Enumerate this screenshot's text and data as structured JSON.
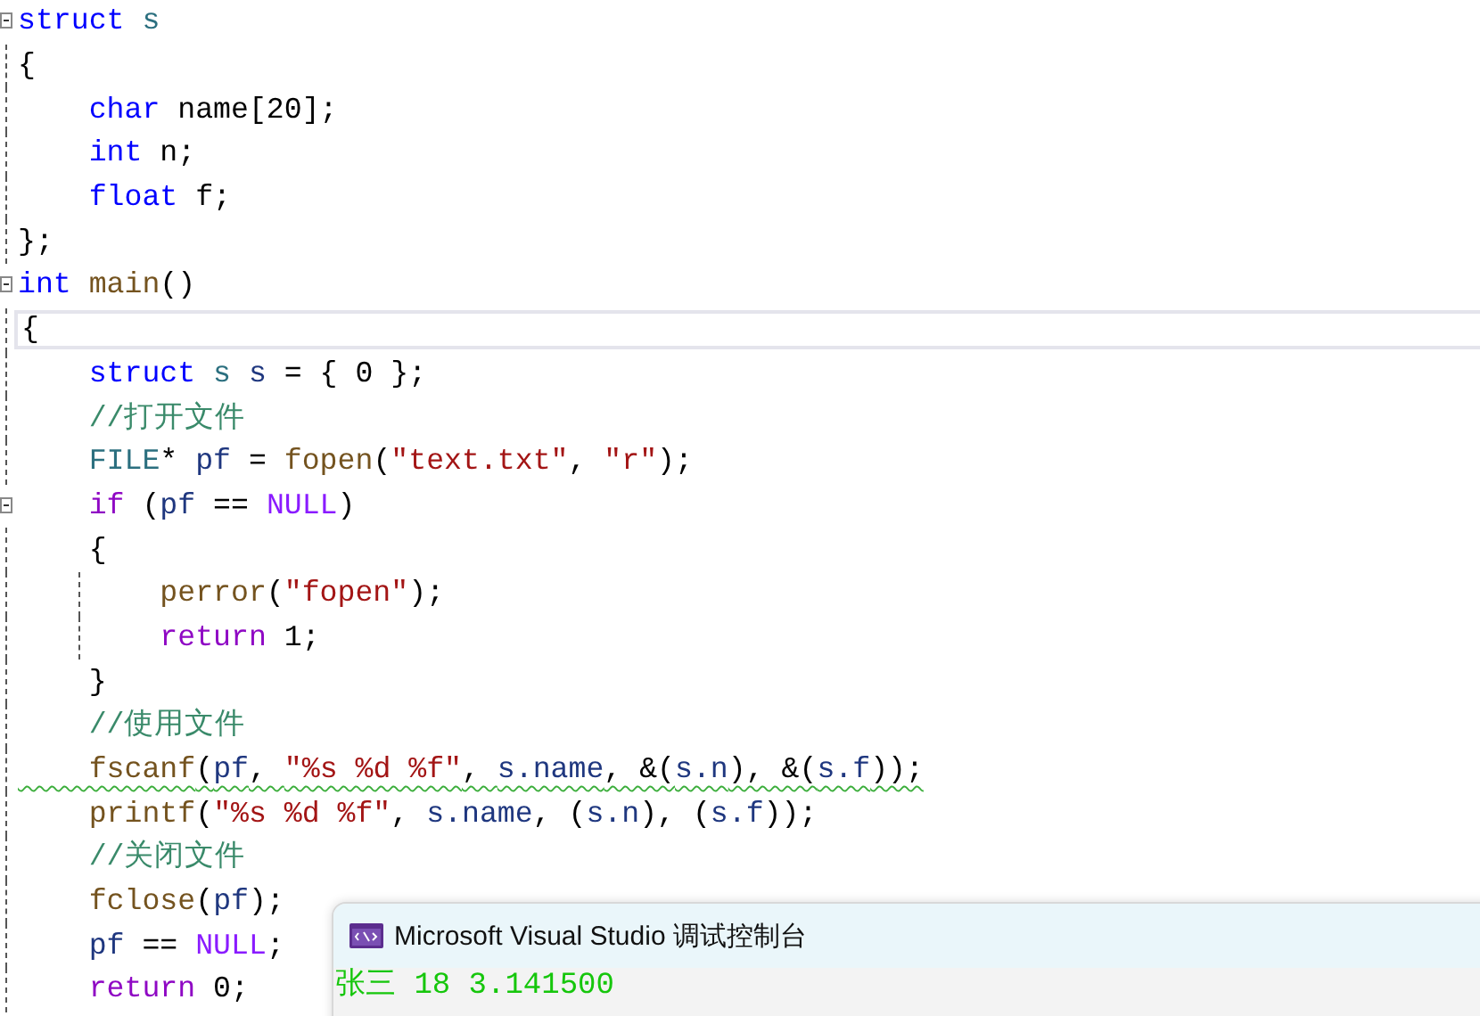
{
  "editor": {
    "lines": [
      {
        "fold_marker": true,
        "current": false,
        "squiggle": false,
        "tokens": [
          {
            "kind": "keyword",
            "text": "struct"
          },
          {
            "kind": "type",
            "text": " s"
          }
        ]
      },
      {
        "fold_marker": false,
        "current": false,
        "squiggle": false,
        "tokens": [
          {
            "kind": "plain",
            "text": "{"
          }
        ]
      },
      {
        "fold_marker": false,
        "current": false,
        "squiggle": false,
        "tokens": [
          {
            "kind": "keyword",
            "text": "    char"
          },
          {
            "kind": "plain",
            "text": " name[20];"
          }
        ]
      },
      {
        "fold_marker": false,
        "current": false,
        "squiggle": false,
        "tokens": [
          {
            "kind": "keyword",
            "text": "    int"
          },
          {
            "kind": "plain",
            "text": " n;"
          }
        ]
      },
      {
        "fold_marker": false,
        "current": false,
        "squiggle": false,
        "tokens": [
          {
            "kind": "keyword",
            "text": "    float"
          },
          {
            "kind": "plain",
            "text": " f;"
          }
        ]
      },
      {
        "fold_marker": false,
        "current": false,
        "squiggle": false,
        "tokens": [
          {
            "kind": "plain",
            "text": "};"
          }
        ]
      },
      {
        "fold_marker": true,
        "current": false,
        "squiggle": false,
        "tokens": [
          {
            "kind": "keyword",
            "text": "int"
          },
          {
            "kind": "function",
            "text": " main"
          },
          {
            "kind": "plain",
            "text": "()"
          }
        ]
      },
      {
        "fold_marker": false,
        "current": true,
        "squiggle": false,
        "tokens": [
          {
            "kind": "plain",
            "text": "{"
          }
        ]
      },
      {
        "fold_marker": false,
        "current": false,
        "squiggle": false,
        "tokens": [
          {
            "kind": "keyword",
            "text": "    struct"
          },
          {
            "kind": "type",
            "text": " s"
          },
          {
            "kind": "variable",
            "text": " s"
          },
          {
            "kind": "plain",
            "text": " = { 0 };"
          }
        ]
      },
      {
        "fold_marker": false,
        "current": false,
        "squiggle": false,
        "tokens": [
          {
            "kind": "comment",
            "text": "    //打开文件"
          }
        ]
      },
      {
        "fold_marker": false,
        "current": false,
        "squiggle": false,
        "tokens": [
          {
            "kind": "type",
            "text": "    FILE"
          },
          {
            "kind": "plain",
            "text": "* "
          },
          {
            "kind": "variable",
            "text": "pf"
          },
          {
            "kind": "plain",
            "text": " = "
          },
          {
            "kind": "function",
            "text": "fopen"
          },
          {
            "kind": "plain",
            "text": "("
          },
          {
            "kind": "string",
            "text": "\"text.txt\""
          },
          {
            "kind": "plain",
            "text": ", "
          },
          {
            "kind": "string",
            "text": "\"r\""
          },
          {
            "kind": "plain",
            "text": ");"
          }
        ]
      },
      {
        "fold_marker": true,
        "current": false,
        "squiggle": false,
        "tokens": [
          {
            "kind": "control",
            "text": "    if"
          },
          {
            "kind": "plain",
            "text": " ("
          },
          {
            "kind": "variable",
            "text": "pf"
          },
          {
            "kind": "plain",
            "text": " == "
          },
          {
            "kind": "macro",
            "text": "NULL"
          },
          {
            "kind": "plain",
            "text": ")"
          }
        ]
      },
      {
        "fold_marker": false,
        "current": false,
        "squiggle": false,
        "tokens": [
          {
            "kind": "plain",
            "text": "    {"
          }
        ]
      },
      {
        "fold_marker": false,
        "current": false,
        "squiggle": false,
        "tokens": [
          {
            "kind": "function",
            "text": "        perror"
          },
          {
            "kind": "plain",
            "text": "("
          },
          {
            "kind": "string",
            "text": "\"fopen\""
          },
          {
            "kind": "plain",
            "text": ");"
          }
        ]
      },
      {
        "fold_marker": false,
        "current": false,
        "squiggle": false,
        "tokens": [
          {
            "kind": "control",
            "text": "        return"
          },
          {
            "kind": "plain",
            "text": " 1;"
          }
        ]
      },
      {
        "fold_marker": false,
        "current": false,
        "squiggle": false,
        "tokens": [
          {
            "kind": "plain",
            "text": "    }"
          }
        ]
      },
      {
        "fold_marker": false,
        "current": false,
        "squiggle": false,
        "tokens": [
          {
            "kind": "comment",
            "text": "    //使用文件"
          }
        ]
      },
      {
        "fold_marker": false,
        "current": false,
        "squiggle": true,
        "tokens": [
          {
            "kind": "function",
            "text": "    fscanf"
          },
          {
            "kind": "plain",
            "text": "("
          },
          {
            "kind": "variable",
            "text": "pf"
          },
          {
            "kind": "plain",
            "text": ", "
          },
          {
            "kind": "string",
            "text": "\"%s %d %f\""
          },
          {
            "kind": "plain",
            "text": ", "
          },
          {
            "kind": "variable",
            "text": "s.name"
          },
          {
            "kind": "plain",
            "text": ", &("
          },
          {
            "kind": "variable",
            "text": "s.n"
          },
          {
            "kind": "plain",
            "text": "), &("
          },
          {
            "kind": "variable",
            "text": "s.f"
          },
          {
            "kind": "plain",
            "text": "));"
          }
        ]
      },
      {
        "fold_marker": false,
        "current": false,
        "squiggle": false,
        "tokens": [
          {
            "kind": "function",
            "text": "    printf"
          },
          {
            "kind": "plain",
            "text": "("
          },
          {
            "kind": "string",
            "text": "\"%s %d %f\""
          },
          {
            "kind": "plain",
            "text": ", "
          },
          {
            "kind": "variable",
            "text": "s.name"
          },
          {
            "kind": "plain",
            "text": ", ("
          },
          {
            "kind": "variable",
            "text": "s.n"
          },
          {
            "kind": "plain",
            "text": "), ("
          },
          {
            "kind": "variable",
            "text": "s.f"
          },
          {
            "kind": "plain",
            "text": "));"
          }
        ]
      },
      {
        "fold_marker": false,
        "current": false,
        "squiggle": false,
        "tokens": [
          {
            "kind": "comment",
            "text": "    //关闭文件"
          }
        ]
      },
      {
        "fold_marker": false,
        "current": false,
        "squiggle": false,
        "tokens": [
          {
            "kind": "function",
            "text": "    fclose"
          },
          {
            "kind": "plain",
            "text": "("
          },
          {
            "kind": "variable",
            "text": "pf"
          },
          {
            "kind": "plain",
            "text": ");"
          }
        ]
      },
      {
        "fold_marker": false,
        "current": false,
        "squiggle": false,
        "tokens": [
          {
            "kind": "variable",
            "text": "    pf"
          },
          {
            "kind": "plain",
            "text": " == "
          },
          {
            "kind": "macro",
            "text": "NULL"
          },
          {
            "kind": "plain",
            "text": ";"
          }
        ]
      },
      {
        "fold_marker": false,
        "current": false,
        "squiggle": false,
        "tokens": [
          {
            "kind": "control",
            "text": "    return"
          },
          {
            "kind": "plain",
            "text": " 0;"
          }
        ]
      }
    ]
  },
  "console": {
    "title": "Microsoft Visual Studio 调试控制台",
    "output": [
      "张三 18 3.141500"
    ]
  }
}
